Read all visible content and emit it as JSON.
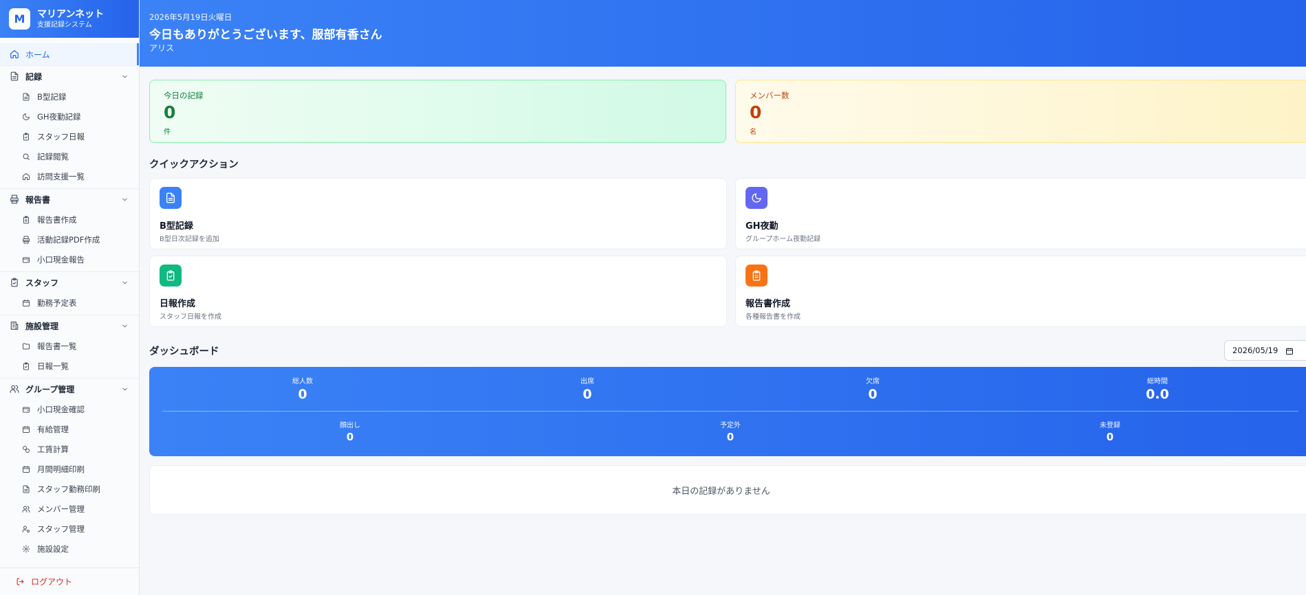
{
  "brand": {
    "logo_letter": "M",
    "name": "マリアンネット",
    "subtitle": "支援記録システム",
    "accent": "#3b82f6"
  },
  "sidebar": {
    "home": {
      "label": "ホーム",
      "icon": "home-icon"
    },
    "sections": [
      {
        "label": "記録",
        "icon": "file-text-icon",
        "items": [
          {
            "label": "B型記録",
            "icon": "file-text-icon"
          },
          {
            "label": "GH夜勤記録",
            "icon": "moon-icon"
          },
          {
            "label": "スタッフ日報",
            "icon": "clipboard-check-icon"
          },
          {
            "label": "記録閲覧",
            "icon": "search-icon"
          },
          {
            "label": "訪問支援一覧",
            "icon": "home-icon"
          }
        ]
      },
      {
        "label": "報告書",
        "icon": "printer-icon",
        "items": [
          {
            "label": "報告書作成",
            "icon": "clipboard-icon"
          },
          {
            "label": "活動記録PDF作成",
            "icon": "printer-icon"
          },
          {
            "label": "小口現金報告",
            "icon": "wallet-icon"
          }
        ]
      },
      {
        "label": "スタッフ",
        "icon": "clipboard-check-icon",
        "items": [
          {
            "label": "勤務予定表",
            "icon": "calendar-icon"
          }
        ]
      },
      {
        "label": "施設管理",
        "icon": "building-icon",
        "items": [
          {
            "label": "報告書一覧",
            "icon": "folder-icon"
          },
          {
            "label": "日報一覧",
            "icon": "clipboard-check-icon"
          }
        ]
      },
      {
        "label": "グループ管理",
        "icon": "users-icon",
        "items": [
          {
            "label": "小口現金確認",
            "icon": "wallet-icon"
          },
          {
            "label": "有給管理",
            "icon": "calendar-icon"
          },
          {
            "label": "工賃計算",
            "icon": "coins-icon"
          },
          {
            "label": "月間明細印刷",
            "icon": "calendar-icon"
          },
          {
            "label": "スタッフ勤務印刷",
            "icon": "file-text-icon"
          },
          {
            "label": "メンバー管理",
            "icon": "users-icon"
          },
          {
            "label": "スタッフ管理",
            "icon": "user-cog-icon"
          },
          {
            "label": "施設設定",
            "icon": "gear-icon"
          }
        ]
      }
    ],
    "logout": "ログアウト"
  },
  "header": {
    "date": "2026年5月19日火曜日",
    "greeting": "今日もありがとうございます、服部有香さん",
    "facility": "アリス"
  },
  "stats": {
    "records": {
      "label": "今日の記録",
      "value": "0",
      "unit": "件",
      "color": "#15803d"
    },
    "members": {
      "label": "メンバー数",
      "value": "0",
      "unit": "名",
      "color": "#c2410c"
    }
  },
  "quick_actions": {
    "title": "クイックアクション",
    "items": [
      {
        "title": "B型記録",
        "desc": "B型日次記録を追加",
        "icon": "file-text-icon",
        "color": "#3b82f6"
      },
      {
        "title": "GH夜勤",
        "desc": "グループホーム夜勤記録",
        "icon": "moon-icon",
        "color": "#6366f1"
      },
      {
        "title": "日報作成",
        "desc": "スタッフ日報を作成",
        "icon": "clipboard-check-icon",
        "color": "#10b981"
      },
      {
        "title": "報告書作成",
        "desc": "各種報告書を作成",
        "icon": "clipboard-icon",
        "color": "#f97316"
      }
    ]
  },
  "dashboard": {
    "title": "ダッシュボード",
    "date": "2026/05/19",
    "row1": [
      {
        "label": "総人数",
        "value": "0"
      },
      {
        "label": "出席",
        "value": "0"
      },
      {
        "label": "欠席",
        "value": "0"
      },
      {
        "label": "総時間",
        "value": "0.0"
      }
    ],
    "row2": [
      {
        "label": "顔出し",
        "value": "0"
      },
      {
        "label": "予定外",
        "value": "0"
      },
      {
        "label": "未登録",
        "value": "0"
      }
    ],
    "empty_message": "本日の記録がありません"
  }
}
